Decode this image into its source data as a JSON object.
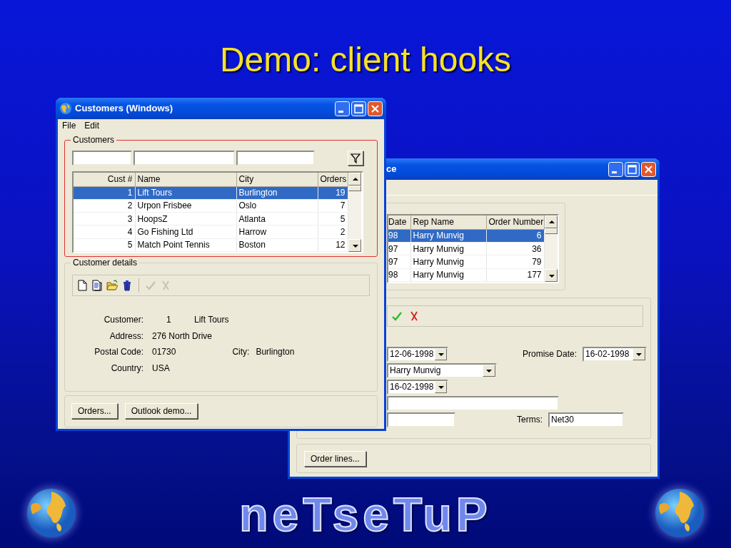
{
  "slide": {
    "title": "Demo: client hooks",
    "logo": "neTseTuP"
  },
  "orders_window": {
    "title": "ce",
    "grid": {
      "columns": [
        "Date",
        "Rep Name",
        "Order Number"
      ],
      "rows": [
        {
          "cells": [
            "98",
            "Harry Munvig",
            "6"
          ],
          "selected": true
        },
        {
          "cells": [
            "97",
            "Harry Munvig",
            "36"
          ],
          "selected": false
        },
        {
          "cells": [
            "97",
            "Harry Munvig",
            "79"
          ],
          "selected": false
        },
        {
          "cells": [
            "98",
            "Harry Munvig",
            "177"
          ],
          "selected": false
        }
      ]
    },
    "toolbar": [
      {
        "kind": "save",
        "disabled": false
      },
      {
        "kind": "cancel",
        "disabled": false
      }
    ],
    "form_rows": [
      [
        {
          "kind": "combo",
          "value": "12-06-1998"
        },
        {
          "kind": "label",
          "text": "Promise Date:"
        },
        {
          "kind": "combo",
          "value": "16-02-1998"
        }
      ],
      [
        {
          "kind": "combo",
          "value": "Harry Munvig"
        }
      ],
      [
        {
          "kind": "combo",
          "value": "16-02-1998"
        }
      ],
      [
        {
          "kind": "text"
        }
      ],
      [
        {
          "kind": "text"
        },
        {
          "kind": "label",
          "text": "Terms:"
        },
        {
          "kind": "text",
          "value": "Net30"
        }
      ]
    ],
    "buttons": [
      "Order lines..."
    ]
  },
  "customers_window": {
    "title": "Customers (Windows)",
    "menu": [
      "File",
      "Edit"
    ],
    "group": "Customers",
    "grid": {
      "columns": [
        "Cust #",
        "Name",
        "City",
        "Orders"
      ],
      "rows": [
        {
          "cells": [
            "1",
            "Lift Tours",
            "Burlington",
            "19"
          ],
          "selected": true
        },
        {
          "cells": [
            "2",
            "Urpon Frisbee",
            "Oslo",
            "7"
          ],
          "selected": false
        },
        {
          "cells": [
            "3",
            "HoopsZ",
            "Atlanta",
            "5"
          ],
          "selected": false
        },
        {
          "cells": [
            "4",
            "Go Fishing Ltd",
            "Harrow",
            "2"
          ],
          "selected": false
        },
        {
          "cells": [
            "5",
            "Match Point Tennis",
            "Boston",
            "12"
          ],
          "selected": false
        }
      ]
    },
    "details": {
      "group": "Customer details",
      "toolbar": [
        {
          "kind": "new",
          "disabled": false
        },
        {
          "kind": "copy",
          "disabled": false
        },
        {
          "kind": "open",
          "disabled": false
        },
        {
          "kind": "delete",
          "disabled": false
        },
        {
          "kind": "save",
          "disabled": true
        },
        {
          "kind": "cancel",
          "disabled": true
        }
      ],
      "fields": [
        {
          "label": "Customer:",
          "values": [
            "1",
            "Lift Tours"
          ]
        },
        {
          "label": "Address:",
          "values": [
            "276 North Drive"
          ]
        },
        {
          "label": "Postal Code:",
          "values": [
            "01730"
          ],
          "side_label": "City:",
          "side_value": "Burlington"
        },
        {
          "label": "Country:",
          "values": [
            "USA"
          ]
        }
      ]
    },
    "buttons": [
      "Orders...",
      "Outlook demo..."
    ]
  }
}
